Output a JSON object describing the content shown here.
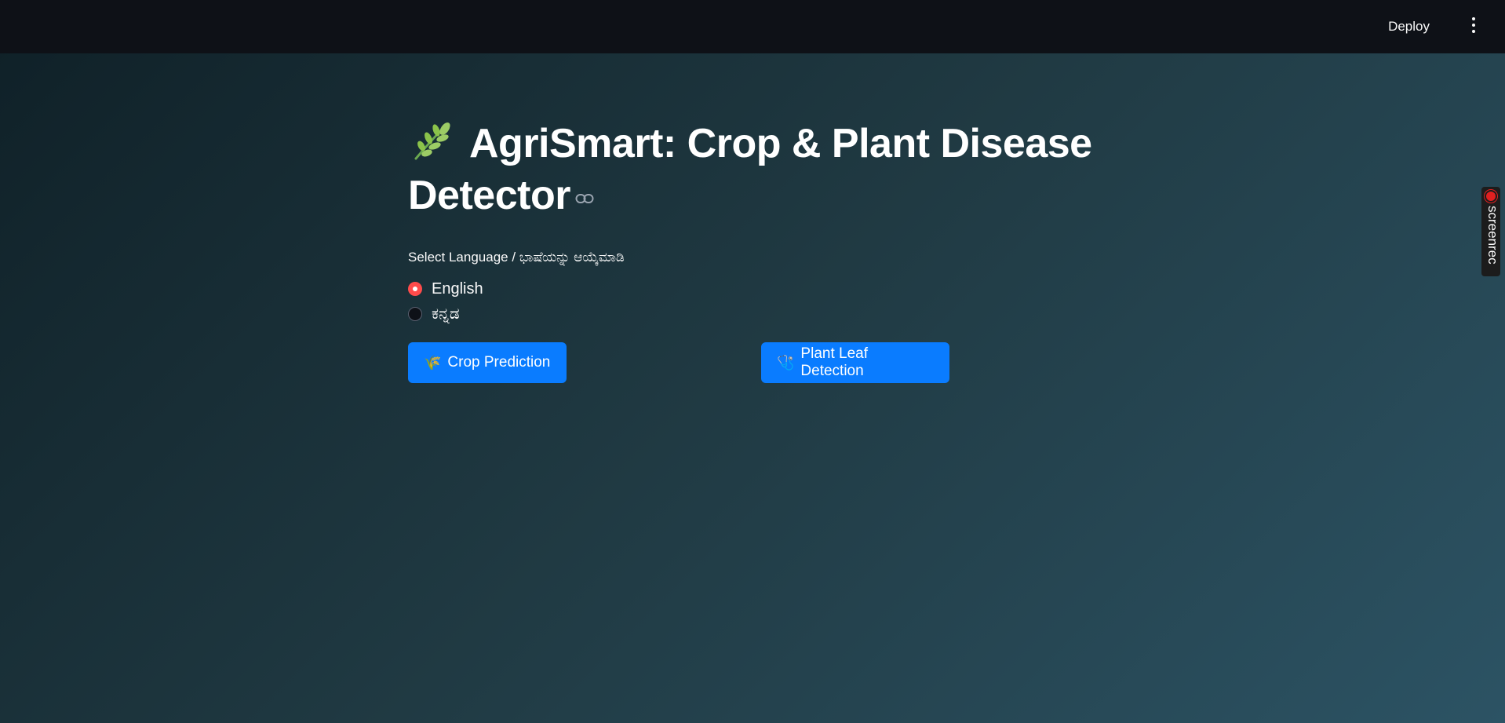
{
  "header": {
    "deploy_label": "Deploy",
    "menu_icon": "kebab-vertical-icon"
  },
  "main": {
    "title_icon": "herb-leaf-icon",
    "title": "AgriSmart: Crop & Plant Disease Detector",
    "language_label": "Select Language / ಭಾಷೆಯನ್ನು ಆಯ್ಕೆಮಾಡಿ",
    "languages": [
      {
        "label": "English",
        "selected": true
      },
      {
        "label": "ಕನ್ನಡ",
        "selected": false
      }
    ],
    "buttons": {
      "crop_icon": "🌾",
      "crop_label": "Crop Prediction",
      "leaf_icon": "🩺",
      "leaf_label": "Plant Leaf Detection"
    }
  },
  "overlay": {
    "screenrec_label": "screenrec"
  },
  "colors": {
    "accent": "#ff4b4b",
    "button": "#0a7cff",
    "topbar": "#0e1117"
  }
}
